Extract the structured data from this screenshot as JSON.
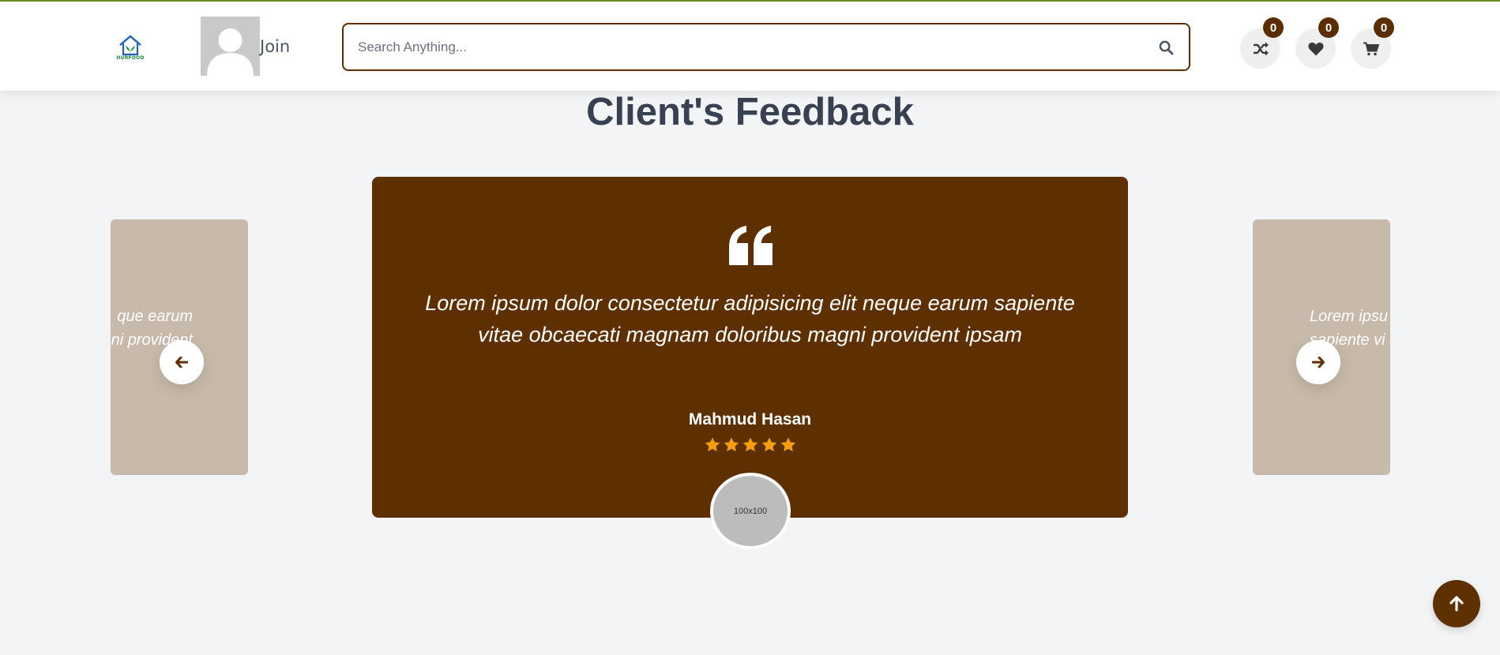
{
  "header": {
    "logo_text": "OURFOOD",
    "join_label": "Join",
    "search": {
      "placeholder": "Search Anything..."
    },
    "compare_count": "0",
    "wishlist_count": "0",
    "cart_count": "0"
  },
  "feedback": {
    "title": "Client's Feedback",
    "active": {
      "quote": "Lorem ipsum dolor consectetur adipisicing elit neque earum sapiente vitae obcaecati magnam doloribus magni provident ipsam",
      "name": "Mahmud Hasan",
      "rating": 5,
      "photo_label": "100x100"
    },
    "prev_card": {
      "line1": "que earum",
      "line2": "ni provident"
    },
    "next_card": {
      "line1": "Lorem ipsu",
      "line2": "sapiente vi"
    }
  },
  "colors": {
    "brand_brown": "#5e3000",
    "side_card": "#c8baaa",
    "star": "#f59e0b",
    "top_line": "#6b8e23"
  },
  "icons": {
    "compare": "shuffle-icon",
    "wishlist": "heart-icon",
    "cart": "cart-icon",
    "search": "search-icon",
    "prev": "arrow-left-icon",
    "next": "arrow-right-icon",
    "back_to_top": "arrow-up-icon",
    "quote": "quote-icon"
  }
}
